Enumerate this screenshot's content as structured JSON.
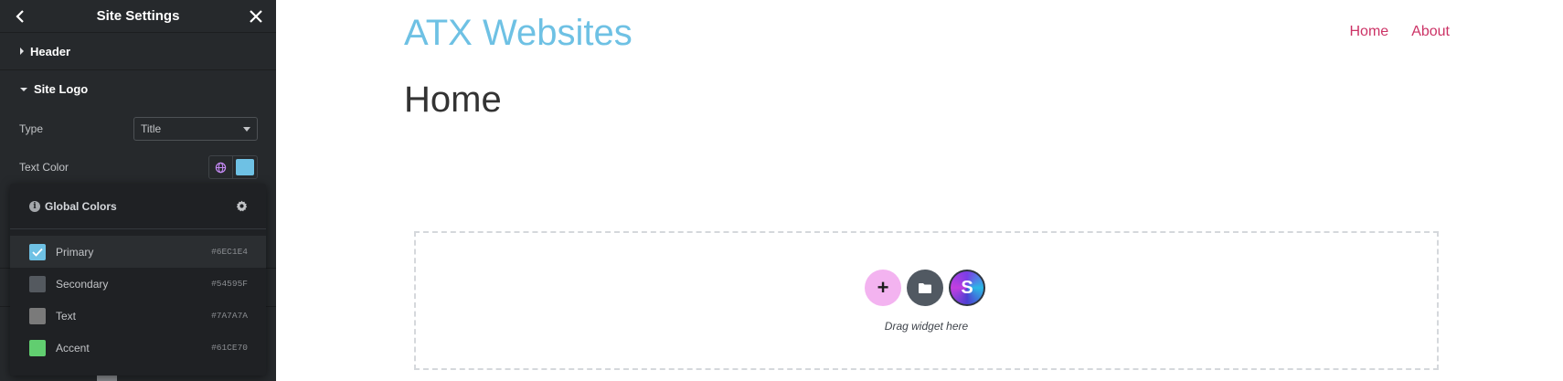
{
  "panel": {
    "title": "Site Settings",
    "sections": [
      {
        "label": "Header",
        "expanded": false
      },
      {
        "label": "Site Logo",
        "expanded": true
      }
    ],
    "type_label": "Type",
    "type_value": "Title",
    "text_color_label": "Text Color",
    "text_color_value": "#6EC1E4",
    "icons": {
      "back": "chevron-left-icon",
      "close": "close-icon",
      "globe": "globe-icon",
      "settings": "gear-icon",
      "info": "info-icon"
    }
  },
  "popover": {
    "title": "Global Colors",
    "colors": [
      {
        "name": "Primary",
        "hex": "#6EC1E4",
        "color": "#6ec1e4",
        "selected": true
      },
      {
        "name": "Secondary",
        "hex": "#54595F",
        "color": "#54595f",
        "selected": false
      },
      {
        "name": "Text",
        "hex": "#7A7A7A",
        "color": "#7a7a7a",
        "selected": false
      },
      {
        "name": "Accent",
        "hex": "#61CE70",
        "color": "#61ce70",
        "selected": false
      }
    ]
  },
  "preview": {
    "site_title": "ATX Websites",
    "nav": [
      "Home",
      "About"
    ],
    "page_title": "Home",
    "dropzone_text": "Drag widget here",
    "colors": {
      "site_title": "#6ec1e4",
      "nav_link": "#cc3366",
      "add_button": "#f3b3f0"
    }
  }
}
